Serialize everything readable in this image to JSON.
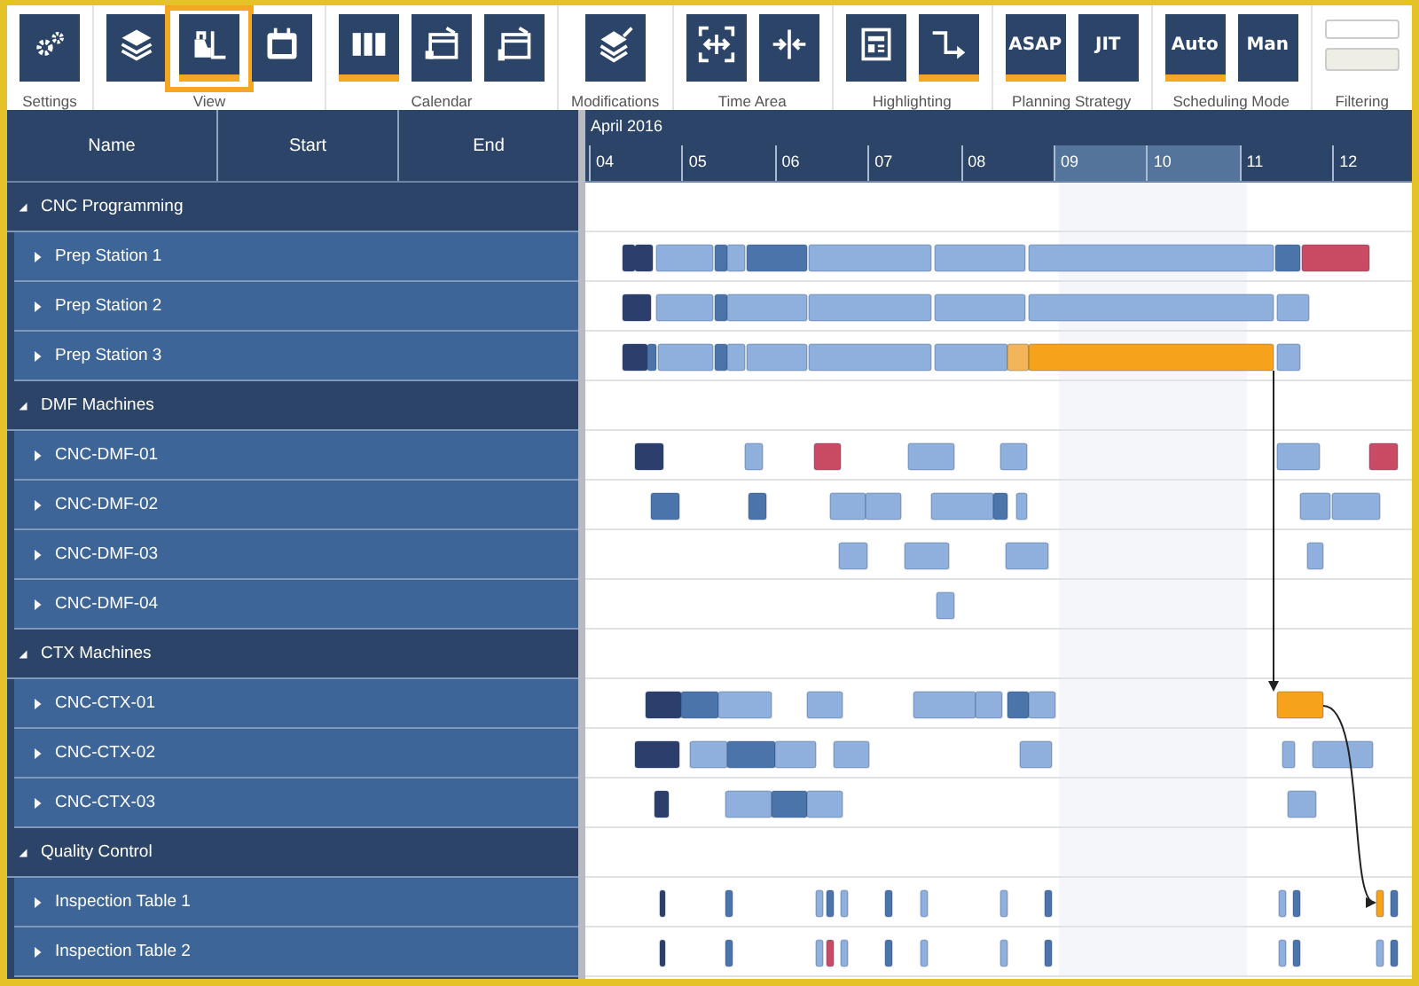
{
  "toolbar": [
    {
      "label": "Settings",
      "kind": "buttons",
      "buttons": [
        {
          "kind": "icon",
          "selected": false,
          "highlighted": false
        }
      ]
    },
    {
      "label": "View",
      "kind": "buttons",
      "buttons": [
        {
          "kind": "icon",
          "selected": false,
          "highlighted": false
        },
        {
          "kind": "icon",
          "selected": true,
          "highlighted": true
        },
        {
          "kind": "icon",
          "selected": false,
          "highlighted": false
        }
      ]
    },
    {
      "label": "Calendar",
      "kind": "buttons",
      "buttons": [
        {
          "kind": "icon",
          "selected": true,
          "highlighted": false
        },
        {
          "kind": "icon",
          "selected": false,
          "highlighted": false
        },
        {
          "kind": "icon",
          "selected": false,
          "highlighted": false
        }
      ]
    },
    {
      "label": "Modifications",
      "kind": "buttons",
      "buttons": [
        {
          "kind": "icon",
          "selected": false,
          "highlighted": false
        }
      ]
    },
    {
      "label": "Time Area",
      "kind": "buttons",
      "buttons": [
        {
          "kind": "icon",
          "selected": false,
          "highlighted": false
        },
        {
          "kind": "icon",
          "selected": false,
          "highlighted": false
        }
      ]
    },
    {
      "label": "Highlighting",
      "kind": "buttons",
      "buttons": [
        {
          "kind": "icon",
          "selected": false,
          "highlighted": false
        },
        {
          "kind": "icon",
          "selected": true,
          "highlighted": false
        }
      ]
    },
    {
      "label": "Planning Strategy",
      "kind": "buttons",
      "buttons": [
        {
          "kind": "text",
          "text": "ASAP",
          "selected": true,
          "highlighted": false
        },
        {
          "kind": "text",
          "text": "JIT",
          "selected": false,
          "highlighted": false
        }
      ]
    },
    {
      "label": "Scheduling Mode",
      "kind": "buttons",
      "buttons": [
        {
          "kind": "text",
          "text": "Auto",
          "selected": true,
          "highlighted": false
        },
        {
          "kind": "text",
          "text": "Man",
          "selected": false,
          "highlighted": false
        }
      ]
    },
    {
      "label": "Filtering",
      "kind": "filter"
    }
  ],
  "columns": [
    "Name",
    "Start",
    "End"
  ],
  "timeline": {
    "month": "April 2016",
    "days": [
      {
        "label": "04",
        "highlighted": false
      },
      {
        "label": "05",
        "highlighted": false
      },
      {
        "label": "06",
        "highlighted": false
      },
      {
        "label": "07",
        "highlighted": false
      },
      {
        "label": "08",
        "highlighted": false
      },
      {
        "label": "09",
        "highlighted": true
      },
      {
        "label": "10",
        "highlighted": true
      },
      {
        "label": "11",
        "highlighted": false
      },
      {
        "label": "12",
        "highlighted": false
      }
    ]
  },
  "groups": [
    {
      "label": "CNC Programming",
      "expanded": true,
      "children": [
        {
          "label": "Prep Station 1",
          "expanded": false
        },
        {
          "label": "Prep Station 2",
          "expanded": false
        },
        {
          "label": "Prep Station 3",
          "expanded": false
        }
      ]
    },
    {
      "label": "DMF Machines",
      "expanded": true,
      "children": [
        {
          "label": "CNC-DMF-01",
          "expanded": false
        },
        {
          "label": "CNC-DMF-02",
          "expanded": false
        },
        {
          "label": "CNC-DMF-03",
          "expanded": false
        },
        {
          "label": "CNC-DMF-04",
          "expanded": false
        }
      ]
    },
    {
      "label": "CTX Machines",
      "expanded": true,
      "children": [
        {
          "label": "CNC-CTX-01",
          "expanded": false
        },
        {
          "label": "CNC-CTX-02",
          "expanded": false
        },
        {
          "label": "CNC-CTX-03",
          "expanded": false
        }
      ]
    },
    {
      "label": "Quality Control",
      "expanded": true,
      "children": [
        {
          "label": "Inspection Table 1",
          "expanded": false
        },
        {
          "label": "Inspection Table 2",
          "expanded": false
        }
      ]
    }
  ]
}
